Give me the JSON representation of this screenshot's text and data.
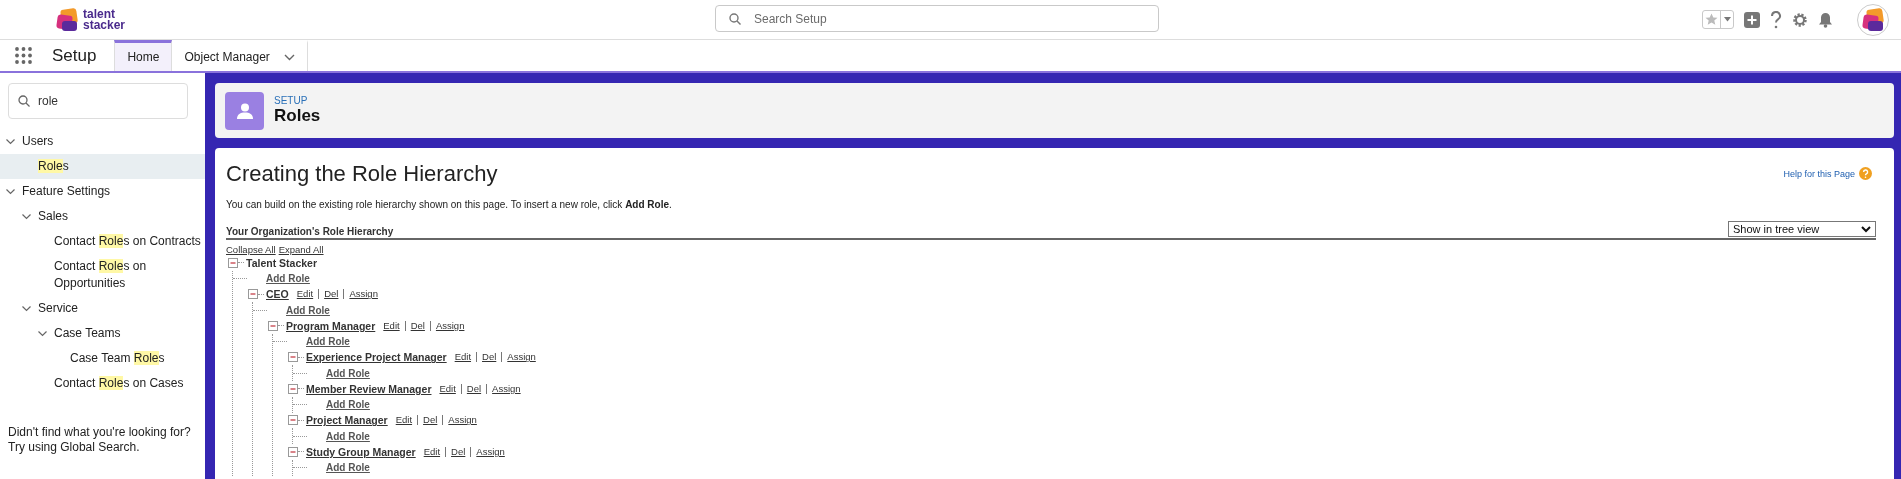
{
  "header": {
    "logo_lines": [
      "talent",
      "stacker"
    ],
    "search": {
      "placeholder": "Search Setup"
    }
  },
  "nav": {
    "app_name": "Setup",
    "tabs": [
      {
        "label": "Home",
        "selected": true,
        "kind": "plain"
      },
      {
        "label": "Object Manager",
        "selected": false,
        "kind": "dropdown"
      }
    ]
  },
  "sidebar": {
    "search": {
      "value": "role"
    },
    "items": [
      {
        "label": [
          {
            "text": "Users",
            "highlighted": false
          }
        ],
        "selected": false,
        "expanded": true,
        "children": [
          {
            "label": [
              {
                "text": "Role",
                "highlighted": true
              },
              {
                "text": "s",
                "highlighted": false
              }
            ],
            "selected": true
          }
        ]
      },
      {
        "label": [
          {
            "text": "Feature Settings",
            "highlighted": false
          }
        ],
        "selected": false,
        "expanded": true,
        "children": [
          {
            "label": [
              {
                "text": "Sales",
                "highlighted": false
              }
            ],
            "selected": false,
            "expanded": true,
            "children": [
              {
                "label": [
                  {
                    "text": "Contact ",
                    "highlighted": false
                  },
                  {
                    "text": "Role",
                    "highlighted": true
                  },
                  {
                    "text": "s on Contracts",
                    "highlighted": false
                  }
                ],
                "selected": false
              },
              {
                "label": [
                  {
                    "text": "Contact ",
                    "highlighted": false
                  },
                  {
                    "text": "Role",
                    "highlighted": true
                  },
                  {
                    "text": "s on Opportunities",
                    "highlighted": false
                  }
                ],
                "selected": false
              }
            ]
          },
          {
            "label": [
              {
                "text": "Service",
                "highlighted": false
              }
            ],
            "selected": false,
            "expanded": true,
            "children": [
              {
                "label": [
                  {
                    "text": "Case Teams",
                    "highlighted": false
                  }
                ],
                "selected": false,
                "expanded": true,
                "children": [
                  {
                    "label": [
                      {
                        "text": "Case Team ",
                        "highlighted": false
                      },
                      {
                        "text": "Role",
                        "highlighted": true
                      },
                      {
                        "text": "s",
                        "highlighted": false
                      }
                    ],
                    "selected": false
                  }
                ]
              },
              {
                "label": [
                  {
                    "text": "Contact ",
                    "highlighted": false
                  },
                  {
                    "text": "Role",
                    "highlighted": true
                  },
                  {
                    "text": "s on Cases",
                    "highlighted": false
                  }
                ],
                "selected": false
              }
            ]
          }
        ]
      }
    ],
    "footer_lines": [
      "Didn't find what you're looking for?",
      "Try using Global Search."
    ]
  },
  "page_header": {
    "eyebrow": "SETUP",
    "title": "Roles"
  },
  "content": {
    "title": "Creating the Role Hierarchy",
    "help_link": "Help for this Page",
    "intro": "You can build on the existing role hierarchy shown on this page. To insert a new role, click **Add Role**.",
    "section_title": "Your Organization's Role Hierarchy",
    "view_select": {
      "value": "Show in tree view"
    },
    "tree_links": [
      "Collapse All",
      "Expand All"
    ],
    "tree": {
      "name": "Talent Stacker",
      "kind": "root",
      "expanded": true,
      "add_role": "Add Role",
      "children": [
        {
          "name": "CEO",
          "kind": "role",
          "expanded": true,
          "actions": [
            "Edit",
            "Del",
            "Assign"
          ],
          "add_role": "Add Role",
          "children": [
            {
              "name": "Program Manager",
              "kind": "role",
              "expanded": true,
              "actions": [
                "Edit",
                "Del",
                "Assign"
              ],
              "add_role": "Add Role",
              "children": [
                {
                  "name": "Experience Project Manager",
                  "kind": "role",
                  "expanded": true,
                  "actions": [
                    "Edit",
                    "Del",
                    "Assign"
                  ],
                  "add_role": "Add Role"
                },
                {
                  "name": "Member Review Manager",
                  "kind": "role",
                  "expanded": true,
                  "actions": [
                    "Edit",
                    "Del",
                    "Assign"
                  ],
                  "add_role": "Add Role"
                },
                {
                  "name": "Project Manager",
                  "kind": "role",
                  "expanded": true,
                  "actions": [
                    "Edit",
                    "Del",
                    "Assign"
                  ],
                  "add_role": "Add Role"
                },
                {
                  "name": "Study Group Manager",
                  "kind": "role",
                  "expanded": true,
                  "actions": [
                    "Edit",
                    "Del",
                    "Assign"
                  ],
                  "add_role": "Add Role"
                }
              ]
            }
          ]
        }
      ]
    }
  }
}
